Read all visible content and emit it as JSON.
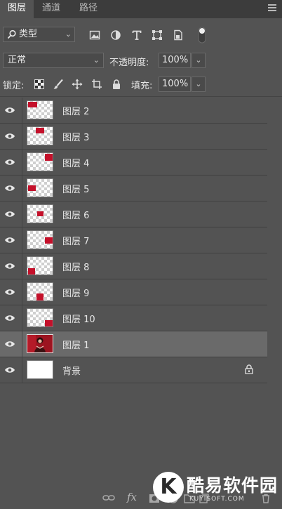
{
  "tabs": [
    "图层",
    "通道",
    "路径"
  ],
  "filter": {
    "label": "类型"
  },
  "blend_mode": "正常",
  "opacity": {
    "label": "不透明度:",
    "value": "100%"
  },
  "lock": {
    "label": "锁定:"
  },
  "fill": {
    "label": "填充:",
    "value": "100%"
  },
  "layers": [
    {
      "name": "图层 2"
    },
    {
      "name": "图层 3"
    },
    {
      "name": "图层 4"
    },
    {
      "name": "图层 5"
    },
    {
      "name": "图层 6"
    },
    {
      "name": "图层 7"
    },
    {
      "name": "图层 8"
    },
    {
      "name": "图层 9"
    },
    {
      "name": "图层 10"
    },
    {
      "name": "图层 1",
      "selected": true
    },
    {
      "name": "背景",
      "locked": true
    }
  ],
  "bottom_icons": [
    "link-icon",
    "fx-icon",
    "mask-icon",
    "adjustment-icon",
    "folder-icon",
    "new-layer-icon",
    "trash-icon"
  ],
  "fx_label": "fx",
  "watermark": {
    "letter": "K",
    "title": "酷易软件园",
    "subtitle": "KUYISOFT.COM"
  },
  "colors": {
    "panel": "#535353",
    "selected_row": "#6a6a6a",
    "tabbar": "#3c3c3c",
    "layer_content": "#c4102a"
  }
}
